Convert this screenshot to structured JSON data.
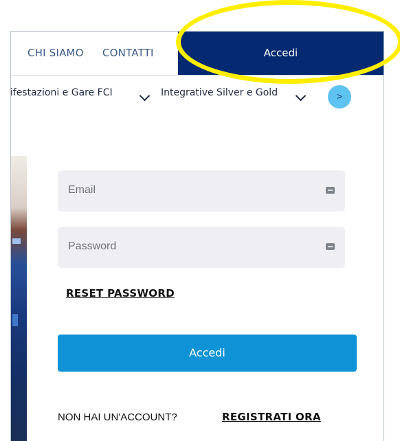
{
  "header": {
    "nav_links": [
      "CHI SIAMO",
      "CONTATTI"
    ],
    "login_label": "Accedi"
  },
  "menu": {
    "items": [
      "nifestazioni e Gare FCI",
      "Integrative Silver e Gold"
    ],
    "next_label": ">"
  },
  "login_form": {
    "email_placeholder": "Email",
    "password_placeholder": "Password",
    "reset_label": "RESET PASSWORD",
    "submit_label": "Accedi",
    "signup_question": "NON HAI UN'ACCOUNT?",
    "signup_link": "REGISTRATI ORA"
  },
  "colors": {
    "header_login_bg": "#052a72",
    "submit_bg": "#0f93d6",
    "next_btn_bg": "#5fc3f1",
    "highlight": "#ffee00"
  },
  "icons": {
    "field_icon": "password-manager-key-icon",
    "menu_chevron": "chevron-down-icon"
  }
}
